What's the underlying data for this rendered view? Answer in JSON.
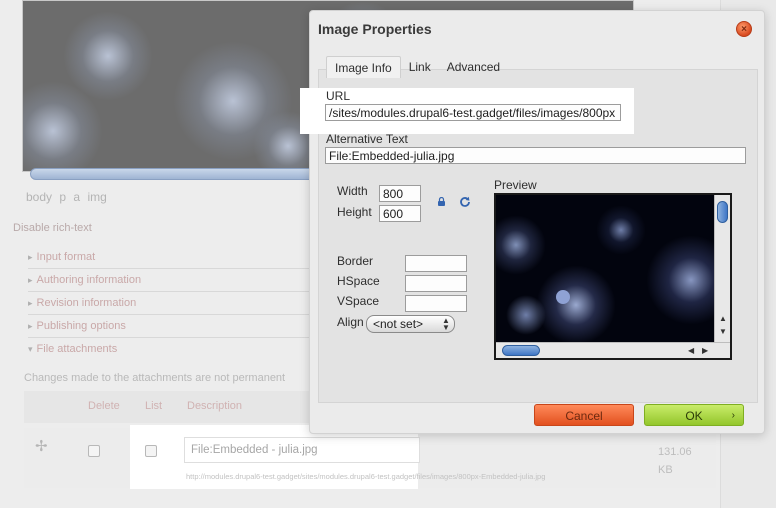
{
  "background": {
    "pathbar": [
      "body",
      "p",
      "a",
      "img"
    ],
    "disable_rich_text": "Disable rich-text",
    "fieldsets": [
      {
        "label": "Input format",
        "expanded": false
      },
      {
        "label": "Authoring information",
        "expanded": false
      },
      {
        "label": "Revision information",
        "expanded": false
      },
      {
        "label": "Publishing options",
        "expanded": false
      },
      {
        "label": "File attachments",
        "expanded": true
      }
    ],
    "attachments_note": "Changes made to the attachments are not permanent",
    "table_headers": {
      "delete": "Delete",
      "list": "List",
      "description": "Description"
    },
    "file_description": "File:Embedded - julia.jpg",
    "file_url": "http://modules.drupal6-test.gadget/sites/modules.drupal6-test.gadget/files/images/800px-Embedded-julia.jpg",
    "file_size": "131.06",
    "file_size_unit": "KB"
  },
  "dialog": {
    "title": "Image Properties",
    "tabs": [
      "Image Info",
      "Link",
      "Advanced"
    ],
    "active_tab": "Image Info",
    "url_label": "URL",
    "url_value": "/sites/modules.drupal6-test.gadget/files/images/800px",
    "alt_label": "Alternative Text",
    "alt_value": "File:Embedded-julia.jpg",
    "width_label": "Width",
    "width_value": "800",
    "height_label": "Height",
    "height_value": "600",
    "border_label": "Border",
    "border_value": "",
    "hspace_label": "HSpace",
    "hspace_value": "",
    "vspace_label": "VSpace",
    "vspace_value": "",
    "align_label": "Align",
    "align_value": "<not set>",
    "preview_label": "Preview",
    "cancel_label": "Cancel",
    "ok_label": "OK"
  },
  "colors": {
    "cancel": "#e2501f",
    "ok": "#93c62b",
    "close": "#d84a20",
    "scroll_thumb": "#3f76c6"
  }
}
